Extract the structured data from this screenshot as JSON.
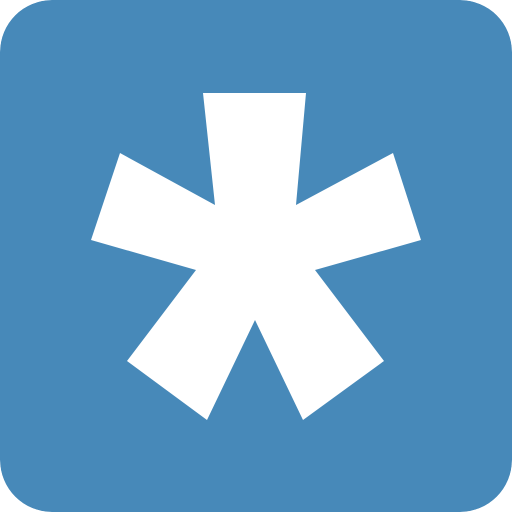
{
  "icon": {
    "name": "asterisk-icon",
    "colors": {
      "background": "#4789b9",
      "glyph": "#ffffff"
    }
  }
}
